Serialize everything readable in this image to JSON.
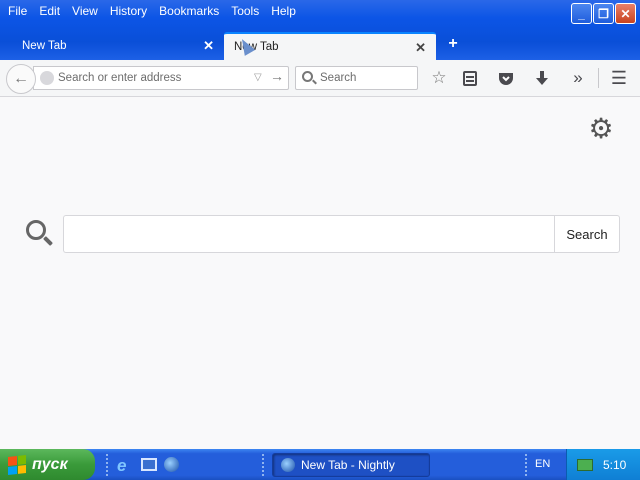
{
  "menubar": {
    "items": [
      {
        "label": "File"
      },
      {
        "label": "Edit"
      },
      {
        "label": "View"
      },
      {
        "label": "History"
      },
      {
        "label": "Bookmarks"
      },
      {
        "label": "Tools"
      },
      {
        "label": "Help"
      }
    ]
  },
  "tabs": [
    {
      "label": "New Tab",
      "active": false
    },
    {
      "label": "New Tab",
      "active": true
    }
  ],
  "toolbar": {
    "url_placeholder": "Search or enter address",
    "search_placeholder": "Search"
  },
  "content": {
    "search_button_label": "Search"
  },
  "taskbar": {
    "start_label": "пуск",
    "task_label": "New Tab - Nightly",
    "language": "EN",
    "clock": "5:10"
  },
  "colors": {
    "xp_blue": "#0c55e6",
    "accent": "#0a84ff",
    "start_green": "#3a9a3a"
  }
}
